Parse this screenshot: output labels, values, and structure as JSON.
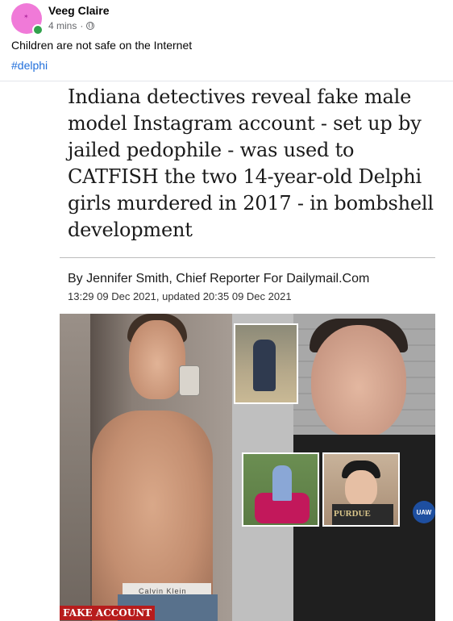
{
  "post": {
    "author": "Veeg Claire",
    "time": "4 mins",
    "separator": "·",
    "privacy_icon": "globe-icon",
    "text": "Children are not safe on the Internet",
    "hashtag": "#delphi"
  },
  "article": {
    "headline": "Indiana detectives reveal fake male model Instagram account - set up by jailed pedophile - was used to CATFISH the two 14-year-old Delphi girls murdered in 2017 - in bombshell development",
    "byline": "By Jennifer Smith, Chief Reporter For Dailymail.Com",
    "dateline": "13:29 09 Dec 2021, updated 20:35 09 Dec 2021",
    "photo": {
      "label": "FAKE ACCOUNT",
      "waistband_text": "Calvin Klein",
      "shirt_text": "PURDUE",
      "badge_text": "UAW"
    }
  },
  "colors": {
    "hashtag": "#216fdb",
    "online": "#31a24c",
    "label_bg": "#b71c1c"
  }
}
